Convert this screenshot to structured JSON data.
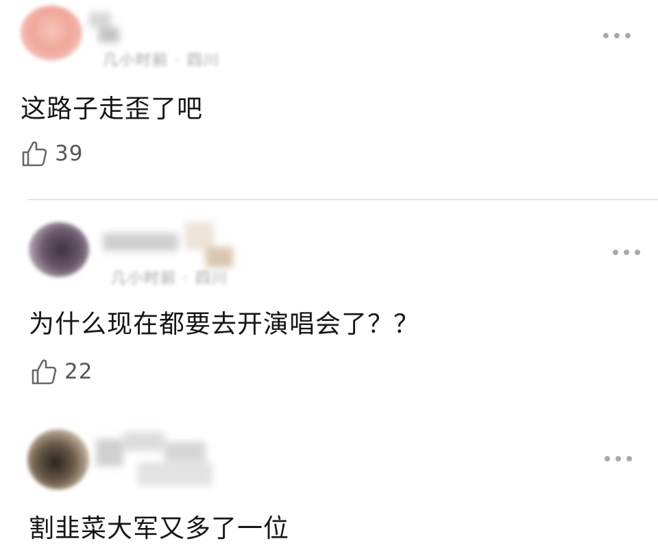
{
  "comments": [
    {
      "meta": "几小时前 · 四川",
      "text": "这路子走歪了吧",
      "likes": "39",
      "avatar_color": "#f0a79a"
    },
    {
      "meta": "几小时前 · 四川",
      "text": "为什么现在都要去开演唱会了？？",
      "likes": "22",
      "avatar_color": "#6a5a6b"
    },
    {
      "meta": "",
      "text": "割韭菜大军又多了一位",
      "likes": "",
      "avatar_color": "#6b5a48"
    }
  ],
  "icons": {
    "like": "thumbs-up-icon",
    "more": "more-dots-icon"
  },
  "colors": {
    "background": "#ffffff",
    "text": "#161616",
    "secondary": "#555555",
    "divider": "#e4e4e4"
  }
}
